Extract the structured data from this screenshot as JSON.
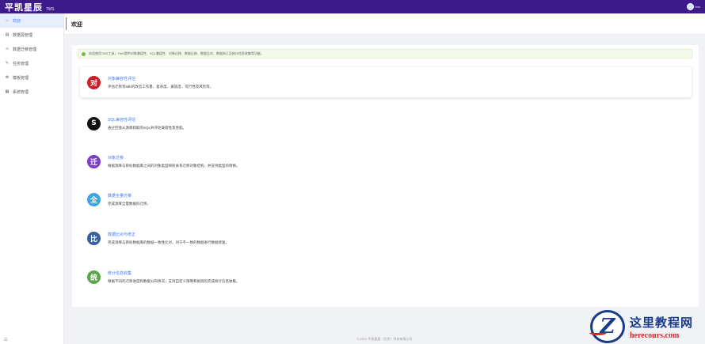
{
  "app": {
    "brand_name": "平凯星辰",
    "brand_sub": "TMS",
    "user_name": "tms"
  },
  "sidebar": {
    "items": [
      {
        "label": "欢迎",
        "icon": "home-icon",
        "glyph": "⌂",
        "active": true
      },
      {
        "label": "数据源管理",
        "icon": "database-icon",
        "glyph": "▤",
        "active": false
      },
      {
        "label": "数据迁移管理",
        "icon": "share-icon",
        "glyph": "⋖",
        "active": false
      },
      {
        "label": "任务管理",
        "icon": "edit-icon",
        "glyph": "✎",
        "active": false
      },
      {
        "label": "模板管理",
        "icon": "settings-icon",
        "glyph": "✻",
        "active": false
      },
      {
        "label": "系统管理",
        "icon": "grid-icon",
        "glyph": "▦",
        "active": false
      }
    ],
    "collapse_glyph": "☰"
  },
  "header": {
    "title": "欢迎"
  },
  "notice": {
    "text": "欢迎使用TMS工具，TMS提供对象兼容性、SQL兼容性、对象迁移、数据迁移、数据比对、数据修正及统计信息收集等功能。"
  },
  "features": [
    {
      "badge": "对",
      "color": "#c6222a",
      "title": "对象兼容性评估",
      "desc": "评估迁移到tidb的改造工作量、复杂度、兼容度、可行性及风险等。"
    },
    {
      "badge": "S",
      "color": "#111111",
      "title": "SQL兼容性评估",
      "desc": "通过回放从源库抓取的SQL并评估兼容性及性能。"
    },
    {
      "badge": "迁",
      "color": "#7b3fc4",
      "title": "对象迁移",
      "desc": "根据源库与目标数据库之间的对象类型映射关系迁移对象结构，并支持类型的转换。"
    },
    {
      "badge": "全",
      "color": "#3aa6e8",
      "title": "数据全量迁移",
      "desc": "完成源库全量数据的迁移。"
    },
    {
      "badge": "比",
      "color": "#3a5f9a",
      "title": "数据比对与修正",
      "desc": "完成源库与目标数据库的数据一致性比对，对于不一致的数据进行数据修复。"
    },
    {
      "badge": "统",
      "color": "#5aa64a",
      "title": "统计信息收集",
      "desc": "根据不同的迁移进度和数据分布情况，支持自定义策略和规则的完成统计信息收集。"
    }
  ],
  "footer": {
    "text": "© 2023 平凯星辰（北京）科技有限公司"
  },
  "watermark": {
    "logo_letter": "Z",
    "site_name": "这里教程网",
    "url": "herecours.com"
  }
}
